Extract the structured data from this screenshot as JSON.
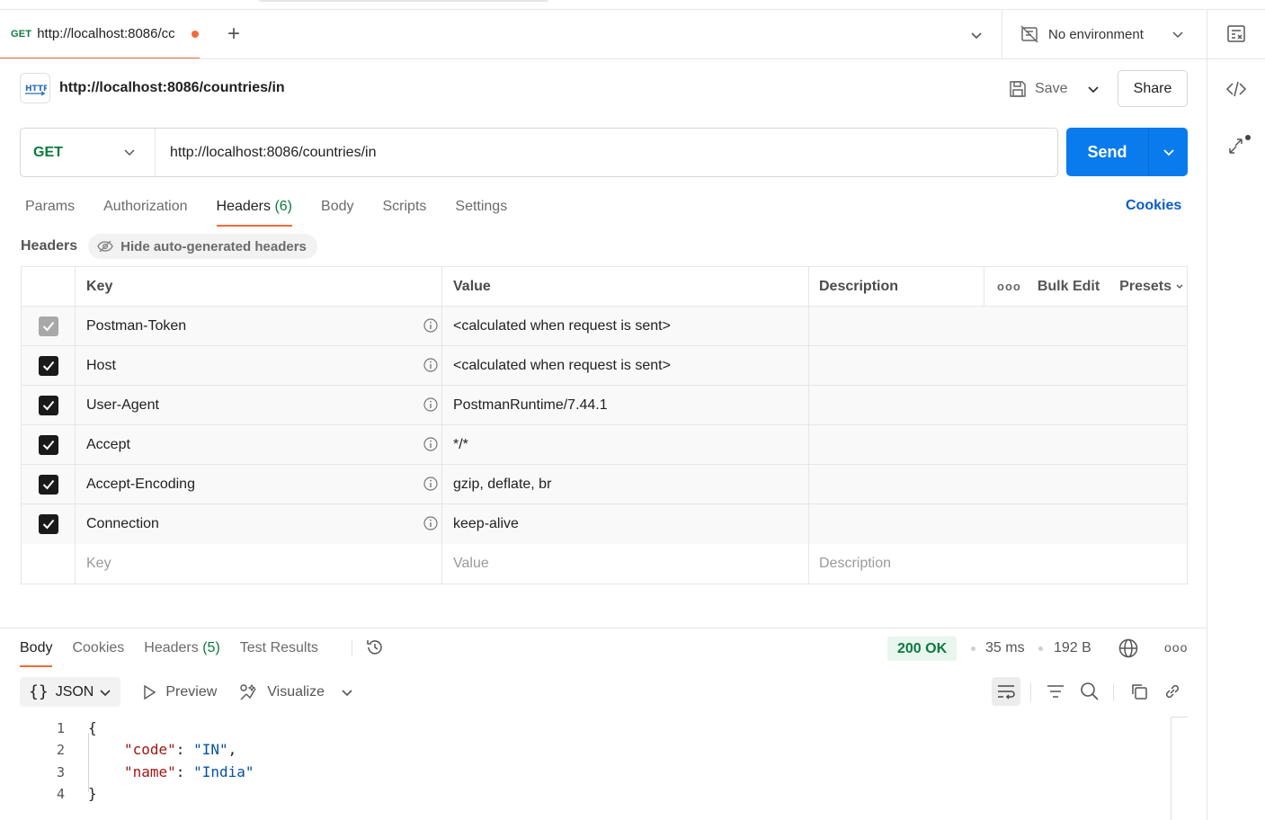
{
  "tab": {
    "method": "GET",
    "title": "http://localhost:8086/cc",
    "new_tab": "+"
  },
  "environment": {
    "label": "No environment"
  },
  "request": {
    "title": "http://localhost:8086/countries/in",
    "save_label": "Save",
    "share_label": "Share",
    "method": "GET",
    "url": "http://localhost:8086/countries/in",
    "send_label": "Send"
  },
  "request_tabs": [
    {
      "label": "Params"
    },
    {
      "label": "Authorization"
    },
    {
      "label": "Headers",
      "count": "(6)"
    },
    {
      "label": "Body"
    },
    {
      "label": "Scripts"
    },
    {
      "label": "Settings"
    }
  ],
  "cookies_label": "Cookies",
  "headers_section": {
    "label": "Headers",
    "toggle": "Hide auto-generated headers"
  },
  "table": {
    "columns": {
      "key": "Key",
      "value": "Value",
      "description": "Description"
    },
    "tools": {
      "more": "ooo",
      "bulk_edit": "Bulk Edit",
      "presets": "Presets"
    },
    "rows": [
      {
        "key": "Postman-Token",
        "value": "<calculated when request is sent>",
        "checked": true,
        "dim": true
      },
      {
        "key": "Host",
        "value": "<calculated when request is sent>",
        "checked": true
      },
      {
        "key": "User-Agent",
        "value": "PostmanRuntime/7.44.1",
        "checked": true
      },
      {
        "key": "Accept",
        "value": "*/*",
        "checked": true
      },
      {
        "key": "Accept-Encoding",
        "value": "gzip, deflate, br",
        "checked": true
      },
      {
        "key": "Connection",
        "value": "keep-alive",
        "checked": true
      }
    ],
    "placeholder": {
      "key": "Key",
      "value": "Value",
      "description": "Description"
    }
  },
  "response": {
    "tabs": [
      {
        "label": "Body"
      },
      {
        "label": "Cookies"
      },
      {
        "label": "Headers",
        "count": "(5)"
      },
      {
        "label": "Test Results"
      }
    ],
    "status": "200 OK",
    "time": "35 ms",
    "size": "192 B",
    "more": "ooo",
    "format": {
      "braces": "{}",
      "type": "JSON",
      "preview": "Preview",
      "visualize": "Visualize"
    },
    "code": {
      "line_numbers": [
        "1",
        "2",
        "3",
        "4"
      ],
      "open": "{",
      "close": "}",
      "fields": [
        {
          "key": "\"code\"",
          "value": "\"IN\"",
          "trail": ","
        },
        {
          "key": "\"name\"",
          "value": "\"India\"",
          "trail": ""
        }
      ]
    }
  },
  "colors": {
    "accent": "#f26b3a",
    "send": "#097bed",
    "get": "#0b7a3e",
    "ok_bg": "#e8f6ee"
  }
}
